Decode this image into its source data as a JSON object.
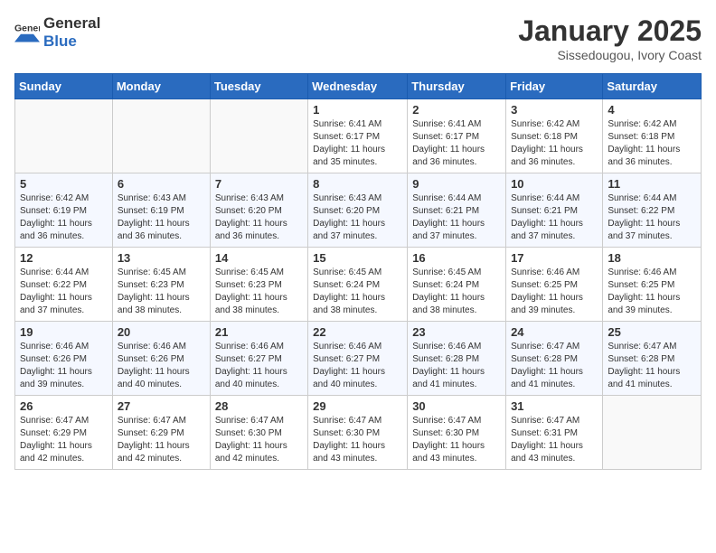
{
  "logo": {
    "text_general": "General",
    "text_blue": "Blue"
  },
  "title": "January 2025",
  "subtitle": "Sissedougou, Ivory Coast",
  "days_of_week": [
    "Sunday",
    "Monday",
    "Tuesday",
    "Wednesday",
    "Thursday",
    "Friday",
    "Saturday"
  ],
  "weeks": [
    [
      {
        "day": "",
        "info": ""
      },
      {
        "day": "",
        "info": ""
      },
      {
        "day": "",
        "info": ""
      },
      {
        "day": "1",
        "info": "Sunrise: 6:41 AM\nSunset: 6:17 PM\nDaylight: 11 hours\nand 35 minutes."
      },
      {
        "day": "2",
        "info": "Sunrise: 6:41 AM\nSunset: 6:17 PM\nDaylight: 11 hours\nand 36 minutes."
      },
      {
        "day": "3",
        "info": "Sunrise: 6:42 AM\nSunset: 6:18 PM\nDaylight: 11 hours\nand 36 minutes."
      },
      {
        "day": "4",
        "info": "Sunrise: 6:42 AM\nSunset: 6:18 PM\nDaylight: 11 hours\nand 36 minutes."
      }
    ],
    [
      {
        "day": "5",
        "info": "Sunrise: 6:42 AM\nSunset: 6:19 PM\nDaylight: 11 hours\nand 36 minutes."
      },
      {
        "day": "6",
        "info": "Sunrise: 6:43 AM\nSunset: 6:19 PM\nDaylight: 11 hours\nand 36 minutes."
      },
      {
        "day": "7",
        "info": "Sunrise: 6:43 AM\nSunset: 6:20 PM\nDaylight: 11 hours\nand 36 minutes."
      },
      {
        "day": "8",
        "info": "Sunrise: 6:43 AM\nSunset: 6:20 PM\nDaylight: 11 hours\nand 37 minutes."
      },
      {
        "day": "9",
        "info": "Sunrise: 6:44 AM\nSunset: 6:21 PM\nDaylight: 11 hours\nand 37 minutes."
      },
      {
        "day": "10",
        "info": "Sunrise: 6:44 AM\nSunset: 6:21 PM\nDaylight: 11 hours\nand 37 minutes."
      },
      {
        "day": "11",
        "info": "Sunrise: 6:44 AM\nSunset: 6:22 PM\nDaylight: 11 hours\nand 37 minutes."
      }
    ],
    [
      {
        "day": "12",
        "info": "Sunrise: 6:44 AM\nSunset: 6:22 PM\nDaylight: 11 hours\nand 37 minutes."
      },
      {
        "day": "13",
        "info": "Sunrise: 6:45 AM\nSunset: 6:23 PM\nDaylight: 11 hours\nand 38 minutes."
      },
      {
        "day": "14",
        "info": "Sunrise: 6:45 AM\nSunset: 6:23 PM\nDaylight: 11 hours\nand 38 minutes."
      },
      {
        "day": "15",
        "info": "Sunrise: 6:45 AM\nSunset: 6:24 PM\nDaylight: 11 hours\nand 38 minutes."
      },
      {
        "day": "16",
        "info": "Sunrise: 6:45 AM\nSunset: 6:24 PM\nDaylight: 11 hours\nand 38 minutes."
      },
      {
        "day": "17",
        "info": "Sunrise: 6:46 AM\nSunset: 6:25 PM\nDaylight: 11 hours\nand 39 minutes."
      },
      {
        "day": "18",
        "info": "Sunrise: 6:46 AM\nSunset: 6:25 PM\nDaylight: 11 hours\nand 39 minutes."
      }
    ],
    [
      {
        "day": "19",
        "info": "Sunrise: 6:46 AM\nSunset: 6:26 PM\nDaylight: 11 hours\nand 39 minutes."
      },
      {
        "day": "20",
        "info": "Sunrise: 6:46 AM\nSunset: 6:26 PM\nDaylight: 11 hours\nand 40 minutes."
      },
      {
        "day": "21",
        "info": "Sunrise: 6:46 AM\nSunset: 6:27 PM\nDaylight: 11 hours\nand 40 minutes."
      },
      {
        "day": "22",
        "info": "Sunrise: 6:46 AM\nSunset: 6:27 PM\nDaylight: 11 hours\nand 40 minutes."
      },
      {
        "day": "23",
        "info": "Sunrise: 6:46 AM\nSunset: 6:28 PM\nDaylight: 11 hours\nand 41 minutes."
      },
      {
        "day": "24",
        "info": "Sunrise: 6:47 AM\nSunset: 6:28 PM\nDaylight: 11 hours\nand 41 minutes."
      },
      {
        "day": "25",
        "info": "Sunrise: 6:47 AM\nSunset: 6:28 PM\nDaylight: 11 hours\nand 41 minutes."
      }
    ],
    [
      {
        "day": "26",
        "info": "Sunrise: 6:47 AM\nSunset: 6:29 PM\nDaylight: 11 hours\nand 42 minutes."
      },
      {
        "day": "27",
        "info": "Sunrise: 6:47 AM\nSunset: 6:29 PM\nDaylight: 11 hours\nand 42 minutes."
      },
      {
        "day": "28",
        "info": "Sunrise: 6:47 AM\nSunset: 6:30 PM\nDaylight: 11 hours\nand 42 minutes."
      },
      {
        "day": "29",
        "info": "Sunrise: 6:47 AM\nSunset: 6:30 PM\nDaylight: 11 hours\nand 43 minutes."
      },
      {
        "day": "30",
        "info": "Sunrise: 6:47 AM\nSunset: 6:30 PM\nDaylight: 11 hours\nand 43 minutes."
      },
      {
        "day": "31",
        "info": "Sunrise: 6:47 AM\nSunset: 6:31 PM\nDaylight: 11 hours\nand 43 minutes."
      },
      {
        "day": "",
        "info": ""
      }
    ]
  ]
}
